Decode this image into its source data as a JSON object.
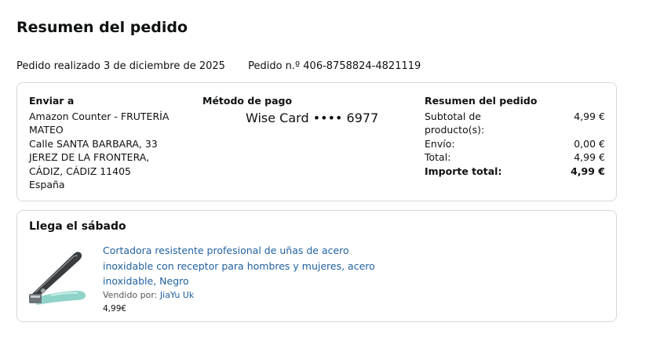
{
  "page": {
    "title": "Resumen del pedido"
  },
  "order": {
    "placed_label": "Pedido realizado 3 de diciembre de 2025",
    "number_label": "Pedido n.º 406-8758824-4821119"
  },
  "shipping": {
    "heading": "Enviar a",
    "lines": [
      "Amazon Counter - FRUTERÍA MATEO",
      "Calle SANTA BARBARA, 33",
      "JEREZ DE LA FRONTERA,",
      "CÁDIZ, CÁDIZ 11405",
      "España"
    ]
  },
  "payment": {
    "heading": "Método de pago",
    "card": "Wise Card •••• 6977"
  },
  "summary": {
    "heading": "Resumen del pedido",
    "rows": [
      {
        "label": "Subtotal de producto(s):",
        "value": "4,99 €"
      },
      {
        "label": "Envío:",
        "value": "0,00 €"
      },
      {
        "label": "Total:",
        "value": "4,99 €"
      },
      {
        "label": "Importe total:",
        "value": "4,99 €"
      }
    ]
  },
  "delivery": {
    "heading": "Llega el sábado",
    "product": {
      "title": "Cortadora resistente profesional de uñas de acero inoxidable con receptor para hombres y mujeres, acero inoxidable, Negro",
      "seller_prefix": "Vendido por:",
      "seller_name": "JiaYu Uk",
      "price": "4,99€",
      "image_icon": "nail-clipper-image"
    }
  },
  "colors": {
    "link": "#2162a1",
    "border": "#d5d9d9",
    "text": "#0f1111",
    "muted": "#565959"
  }
}
